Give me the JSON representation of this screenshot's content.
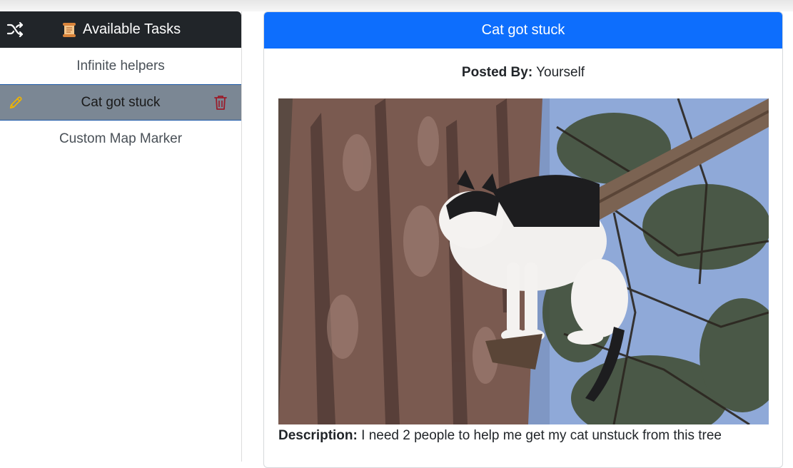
{
  "sidebar": {
    "header_title": "Available Tasks",
    "header_icon": "scroll-icon",
    "shuffle_icon": "shuffle-icon",
    "items": [
      {
        "label": "Infinite helpers",
        "active": false
      },
      {
        "label": "Cat got stuck",
        "active": true,
        "left_icon": "pencil-icon",
        "right_icon": "trash-icon"
      },
      {
        "label": "Custom Map Marker",
        "active": false
      }
    ]
  },
  "detail": {
    "title": "Cat got stuck",
    "posted_by_label": "Posted By:",
    "posted_by_value": "Yourself",
    "description_label": "Description:",
    "description_value": "I need 2 people to help me get my cat unstuck from this tree"
  },
  "colors": {
    "sidebar_header": "#212529",
    "card_header": "#0d6efd",
    "active_item": "#7b8794",
    "pencil": "#f0b400",
    "trash": "#9b1c2a"
  }
}
